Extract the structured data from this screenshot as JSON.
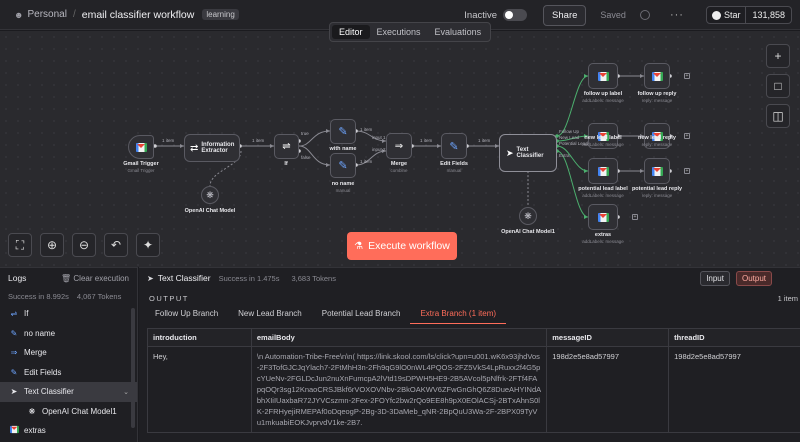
{
  "header": {
    "breadcrumb_personal": "Personal",
    "breadcrumb_sep": "/",
    "workflow_title": "email classifier workflow",
    "tag": "learning",
    "status_label": "Inactive",
    "share_label": "Share",
    "saved_label": "Saved",
    "github_star_label": "Star",
    "github_star_count": "131,858"
  },
  "tabs": [
    "Editor",
    "Executions",
    "Evaluations"
  ],
  "nodes": {
    "gmail_trigger": {
      "label": "Gmail Trigger",
      "sub": "Gmail Trigger"
    },
    "info_extractor": {
      "label": "Information Extractor"
    },
    "openai_model_1": {
      "label": "OpenAI Chat Model"
    },
    "if": {
      "label": "If"
    },
    "with_name": {
      "label": "with name",
      "sub": "manual"
    },
    "no_name": {
      "label": "no name",
      "sub": "manual"
    },
    "merge": {
      "label": "Merge",
      "sub": "combine"
    },
    "edit_fields": {
      "label": "Edit Fields",
      "sub": "manual"
    },
    "text_classifier": {
      "label": "Text Classifier"
    },
    "openai_model_2": {
      "label": "OpenAI Chat Model1"
    },
    "follow_up_label": {
      "label": "follow up label",
      "sub": "addLabels: message"
    },
    "follow_up_reply": {
      "label": "follow up reply",
      "sub": "reply: message"
    },
    "new_lead_label": {
      "label": "new lead label",
      "sub": "addLabels: message"
    },
    "new_lead_reply": {
      "label": "new lead reply",
      "sub": "reply: message"
    },
    "potential_lead_label": {
      "label": "potential lead label",
      "sub": "addLabels: message"
    },
    "potential_lead_reply": {
      "label": "potential lead reply",
      "sub": "reply: message"
    },
    "extras": {
      "label": "extras",
      "sub": "addLabels: message"
    }
  },
  "edge_labels": {
    "e1": "1 item",
    "e2": "1 item",
    "e3": "true",
    "e4": "false",
    "e5": "1 item",
    "e6": "1 item",
    "e7": "input 1",
    "e8": "input 2",
    "e9": "1 item",
    "e10": "1 item",
    "tc_out1": "Follow Up",
    "tc_out2": "New Lead",
    "tc_out3": "Potential Lead",
    "tc_out4": "Extra"
  },
  "execute_label": "Execute workflow",
  "logs": {
    "title": "Logs",
    "clear_label": "Clear execution",
    "success_text": "Success in 8.992s",
    "tokens_text": "4,067 Tokens",
    "items": [
      {
        "label": "If",
        "icon": "if-icon"
      },
      {
        "label": "no name",
        "icon": "pencil-icon"
      },
      {
        "label": "Merge",
        "icon": "merge-icon"
      },
      {
        "label": "Edit Fields",
        "icon": "pencil-icon"
      },
      {
        "label": "Text Classifier",
        "icon": "tag-icon"
      },
      {
        "label": "OpenAI Chat Model1",
        "icon": "openai-icon"
      },
      {
        "label": "extras",
        "icon": "gmail-icon"
      }
    ]
  },
  "output": {
    "node_title": "Text Classifier",
    "success_text": "Success in 1.475s",
    "tokens_text": "3,683 Tokens",
    "input_label": "Input",
    "output_label": "Output",
    "section_label": "OUTPUT",
    "items_count": "1 item",
    "branch_tabs": [
      "Follow Up Branch",
      "New Lead Branch",
      "Potential Lead Branch",
      "Extra Branch (1 item)"
    ],
    "columns": [
      "introduction",
      "emailBody",
      "messageID",
      "threadID"
    ],
    "row": {
      "introduction": "Hey,",
      "emailBody": "\\n Automation-Tribe-Free\\n\\n( https://link.skool.com/ls/click?upn=u001.wK6x93jhdVos-2F3TofGJCJqYlach7-2FtMhH3n-2Fh9qG9lO0nWL4PQOS-2FZ5VkS4LpRuxx2f4G5pcYUeNv-2FGLDcJun2nuXnFumcpA2lVtd19sDPWH5HE9-2B5AVcol5pNlfrk-2FTf4FApqOQr3sg12KnaoCRSJBkf6rVOXOVNbv-2BkOAKWV6ZFwGnGhQ6Z8DueAHYINdAbhXIiIUaxbaR72JYVCszmn-2Fex-2FOYfc2bw2rQo9EE8h9pX0EOlACSj-2BTxAhnS0lK-2FRHyejiRMEPAf0oDqeogP-2Bg-3D-3DaMeb_qNR-2BpQuU3Wa-2F-2BPX09TyVu1mkuabiEOKJvprvdV1ke-2B7.",
      "messageID": "198d2e5e8ad57997",
      "threadID": "198d2e5e8ad57997"
    }
  }
}
